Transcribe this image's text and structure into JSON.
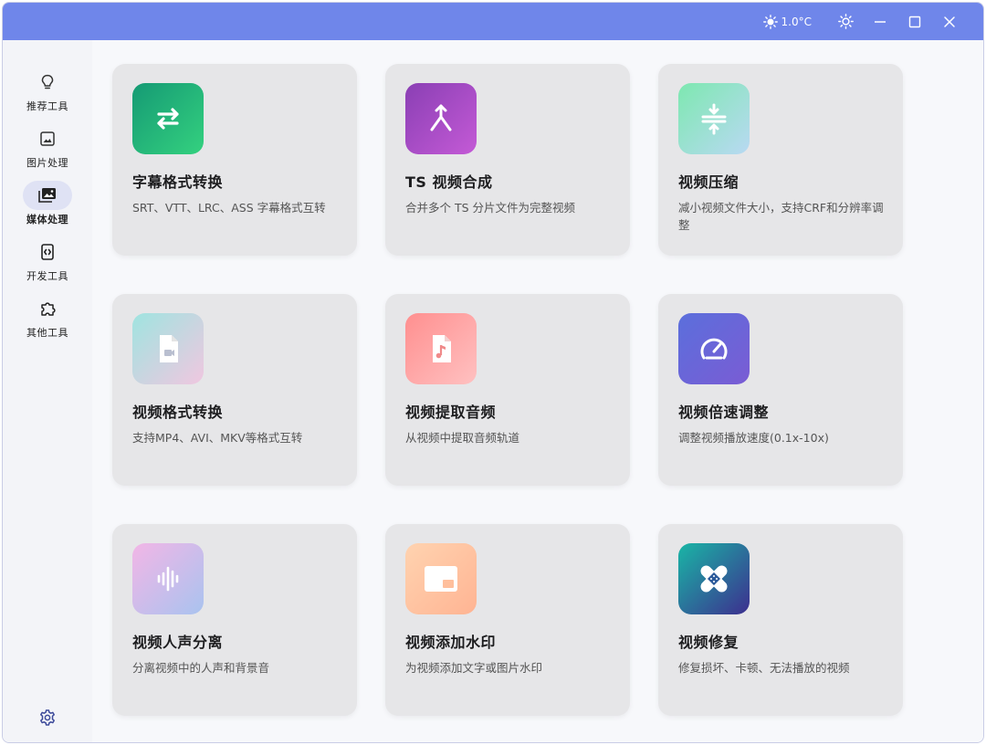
{
  "titlebar": {
    "weather_temp": "1.0°C"
  },
  "sidebar": {
    "items": [
      {
        "label": "推荐工具",
        "icon": "lightbulb-icon",
        "active": false
      },
      {
        "label": "图片处理",
        "icon": "image-icon",
        "active": false
      },
      {
        "label": "媒体处理",
        "icon": "media-library-icon",
        "active": true
      },
      {
        "label": "开发工具",
        "icon": "dev-code-icon",
        "active": false
      },
      {
        "label": "其他工具",
        "icon": "puzzle-icon",
        "active": false
      }
    ]
  },
  "cards": [
    {
      "title": "字幕格式转换",
      "desc": "SRT、VTT、LRC、ASS 字幕格式互转",
      "icon": "swap-arrows-icon"
    },
    {
      "title": "TS 视频合成",
      "desc": "合并多个 TS 分片文件为完整视频",
      "icon": "merge-icon"
    },
    {
      "title": "视频压缩",
      "desc": "减小视频文件大小，支持CRF和分辨率调整",
      "icon": "compress-icon"
    },
    {
      "title": "视频格式转换",
      "desc": "支持MP4、AVI、MKV等格式互转",
      "icon": "video-file-icon"
    },
    {
      "title": "视频提取音频",
      "desc": "从视频中提取音频轨道",
      "icon": "audio-file-icon"
    },
    {
      "title": "视频倍速调整",
      "desc": "调整视频播放速度(0.1x-10x)",
      "icon": "speedometer-icon"
    },
    {
      "title": "视频人声分离",
      "desc": "分离视频中的人声和背景音",
      "icon": "voice-wave-icon"
    },
    {
      "title": "视频添加水印",
      "desc": "为视频添加文字或图片水印",
      "icon": "watermark-icon"
    },
    {
      "title": "视频修复",
      "desc": "修复损坏、卡顿、无法播放的视频",
      "icon": "bandage-icon"
    }
  ],
  "colors": {
    "titlebar": "#6f86ea",
    "active_nav": "#dfe2f4",
    "card_bg": "#e6e6e8"
  }
}
